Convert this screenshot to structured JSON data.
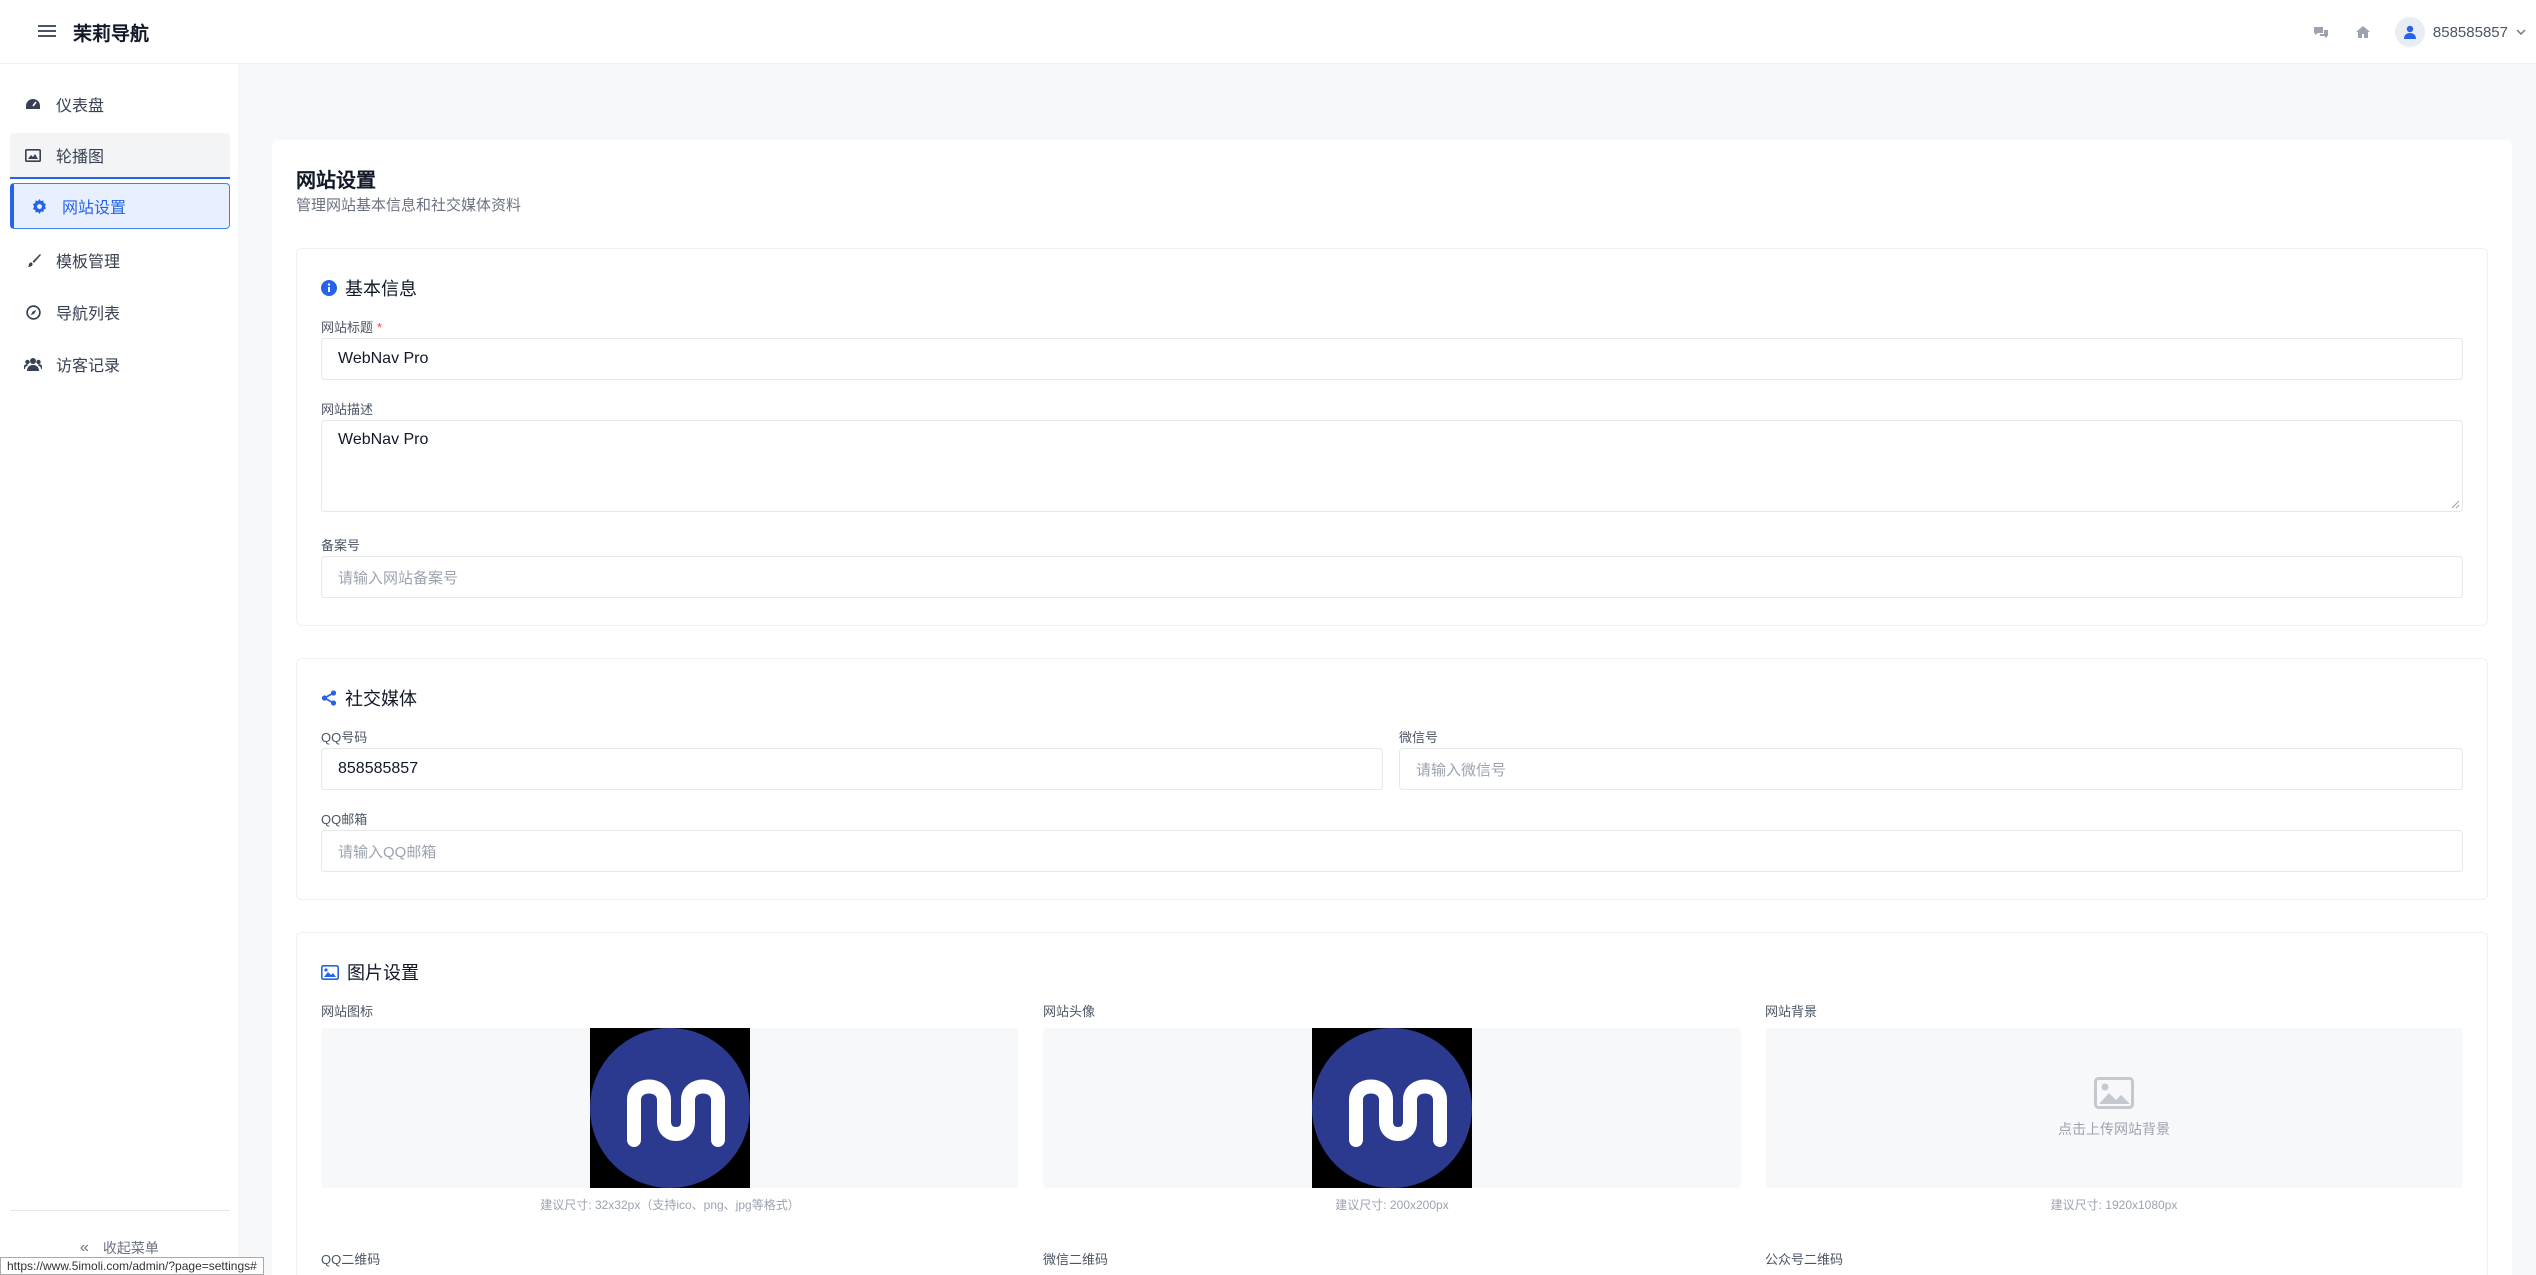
{
  "header": {
    "brand": "茉莉导航",
    "user_name": "858585857"
  },
  "sidebar": {
    "items": [
      {
        "label": "仪表盘",
        "icon": "dashboard-icon"
      },
      {
        "label": "轮播图",
        "icon": "image-icon"
      },
      {
        "label": "网站设置",
        "icon": "gear-icon"
      },
      {
        "label": "模板管理",
        "icon": "brush-icon"
      },
      {
        "label": "导航列表",
        "icon": "compass-icon"
      },
      {
        "label": "访客记录",
        "icon": "users-icon"
      }
    ],
    "active_index": 2,
    "collapse_label": "收起菜单"
  },
  "status_url": "https://www.5imoli.com/admin/?page=settings#",
  "page": {
    "title": "网站设置",
    "subtitle": "管理网站基本信息和社交媒体资料"
  },
  "basic": {
    "title": "基本信息",
    "site_title_label": "网站标题",
    "required_mark": "*",
    "site_title_value": "WebNav Pro",
    "site_desc_label": "网站描述",
    "site_desc_value": "WebNav Pro",
    "icp_label": "备案号",
    "icp_placeholder": "请输入网站备案号"
  },
  "social": {
    "title": "社交媒体",
    "qq_label": "QQ号码",
    "qq_value": "858585857",
    "wechat_label": "微信号",
    "wechat_placeholder": "请输入微信号",
    "email_label": "QQ邮箱",
    "email_placeholder": "请输入QQ邮箱"
  },
  "images": {
    "title": "图片设置",
    "icon_label": "网站图标",
    "icon_hint": "建议尺寸: 32x32px（支持ico、png、jpg等格式）",
    "avatar_label": "网站头像",
    "avatar_hint": "建议尺寸: 200x200px",
    "bg_label": "网站背景",
    "bg_upload_text": "点击上传网站背景",
    "bg_hint": "建议尺寸: 1920x1080px",
    "qq_qr_label": "QQ二维码",
    "wechat_qr_label": "微信二维码",
    "mp_qr_label": "公众号二维码"
  },
  "colors": {
    "accent": "#2563eb",
    "logo_circle": "#2b3a8f"
  }
}
